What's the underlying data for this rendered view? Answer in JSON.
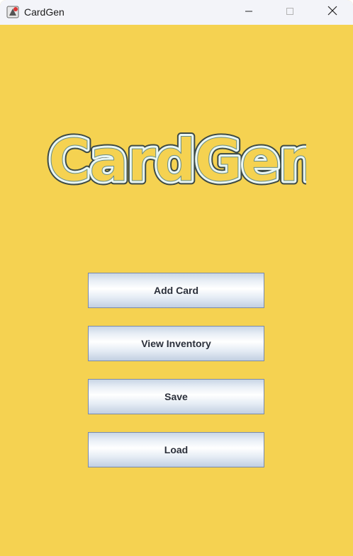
{
  "window": {
    "title": "CardGen",
    "app_icon": "app-icon",
    "controls": {
      "minimize_icon": "minimize-icon",
      "maximize_icon": "maximize-icon",
      "close_icon": "close-icon"
    }
  },
  "logo": {
    "text": "CardGen"
  },
  "menu": {
    "add_card_label": "Add Card",
    "view_inventory_label": "View Inventory",
    "save_label": "Save",
    "load_label": "Load"
  },
  "colors": {
    "background": "#f5d251",
    "titlebar": "#f3f4f9",
    "logo_fill": "#eaf7f4",
    "logo_outline": "#3d4a45"
  }
}
